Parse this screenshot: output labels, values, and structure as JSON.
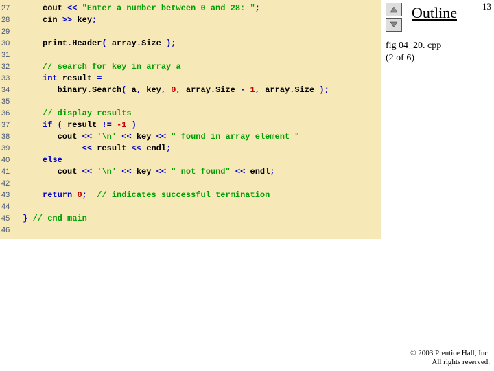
{
  "page_number": "13",
  "outline_label": "Outline",
  "file_name": "fig 04_20. cpp",
  "file_part": "(2 of 6)",
  "copyright_line1": "© 2003 Prentice Hall, Inc.",
  "copyright_line2": "All rights reserved.",
  "lines": {
    "l27": {
      "n": "27",
      "pre": "     cout ",
      "op1": "<<",
      "s1": " \"Enter a number between 0 and 28: \"",
      "tail": ";"
    },
    "l28": {
      "n": "28",
      "pre": "     cin ",
      "op1": ">>",
      "mid": " key",
      "tail": ";"
    },
    "l29": {
      "n": "29",
      "blank": " "
    },
    "l30": {
      "n": "30",
      "pre": "     print",
      "op1": ".",
      "mid1": "Header",
      "op2": "(",
      "mid2": " array",
      "op3": ".",
      "mid3": "Size ",
      "op4": ");"
    },
    "l31": {
      "n": "31",
      "blank": " "
    },
    "l32": {
      "n": "32",
      "pre": "     ",
      "cmt": "// search for key in array a"
    },
    "l33": {
      "n": "33",
      "pre": "     ",
      "kw": "int",
      "mid": " result ",
      "op": "="
    },
    "l34": {
      "n": "34",
      "pre": "        binary",
      "op1": ".",
      "mid1": "Search",
      "op2": "(",
      "mid2": " a",
      "c1": ",",
      "mid3": " key",
      "c2": ",",
      "sp1": " ",
      "n1": "0",
      "c3": ",",
      "mid4": " array",
      "op3": ".",
      "mid5": "Size ",
      "op4": "-",
      "sp2": " ",
      "n2": "1",
      "c4": ",",
      "mid6": " array",
      "op5": ".",
      "mid7": "Size ",
      "op6": ");"
    },
    "l35": {
      "n": "35",
      "blank": " "
    },
    "l36": {
      "n": "36",
      "pre": "     ",
      "cmt": "// display results"
    },
    "l37": {
      "n": "37",
      "pre": "     ",
      "kw": "if",
      "sp": " ",
      "op1": "(",
      "mid": " result ",
      "op2": "!=",
      "sp2": " ",
      "num": "-1",
      "sp3": " ",
      "op3": ")"
    },
    "l38": {
      "n": "38",
      "pre": "        cout ",
      "op1": "<<",
      "sp1": " ",
      "s1": "'\\n'",
      "sp2": " ",
      "op2": "<<",
      "mid": " key ",
      "op3": "<<",
      "sp3": " ",
      "s2": "\" found in array element \""
    },
    "l39": {
      "n": "39",
      "pre": "             ",
      "op1": "<<",
      "mid": " result ",
      "op2": "<<",
      "mid2": " endl",
      "tail": ";"
    },
    "l40": {
      "n": "40",
      "pre": "     ",
      "kw": "else"
    },
    "l41": {
      "n": "41",
      "pre": "        cout ",
      "op1": "<<",
      "sp1": " ",
      "s1": "'\\n'",
      "sp2": " ",
      "op2": "<<",
      "mid": " key ",
      "op3": "<<",
      "sp3": " ",
      "s2": "\" not found\"",
      "sp4": " ",
      "op4": "<<",
      "mid2": " endl",
      "tail": ";"
    },
    "l42": {
      "n": "42",
      "blank": " "
    },
    "l43": {
      "n": "43",
      "pre": "     ",
      "kw": "return",
      "sp": " ",
      "num": "0",
      "tail": ";",
      "sp2": "  ",
      "cmt": "// indicates successful termination"
    },
    "l44": {
      "n": "44",
      "blank": " "
    },
    "l45": {
      "n": "45",
      "pre": " ",
      "op": "}",
      "sp": " ",
      "cmt": "// end main"
    },
    "l46": {
      "n": "46",
      "blank": " "
    }
  }
}
